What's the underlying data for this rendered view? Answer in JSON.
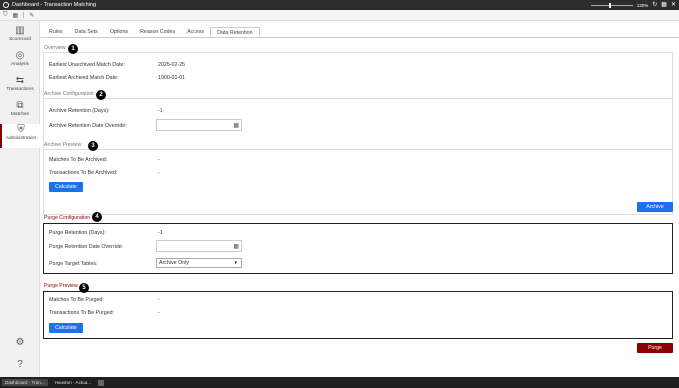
{
  "window": {
    "title": "Dashboard - Transaction Matching",
    "zoom": "130%"
  },
  "sidebar": {
    "items": [
      {
        "label": "Scorecard",
        "icon": "bar-chart-icon"
      },
      {
        "label": "Analysis",
        "icon": "analysis-icon"
      },
      {
        "label": "Transactions",
        "icon": "transactions-icon"
      },
      {
        "label": "Matches",
        "icon": "matches-icon"
      },
      {
        "label": "Administration",
        "icon": "shield-icon"
      }
    ]
  },
  "tabs": [
    "Rules",
    "Data Sets",
    "Options",
    "Reason Codes",
    "Access",
    "Data Retention"
  ],
  "overview": {
    "title": "Overview",
    "badge": "1",
    "rows": [
      {
        "label": "Earliest Unarchived Match Date:",
        "value": "2025-02-25"
      },
      {
        "label": "Earliest Archived Match Date:",
        "value": "1900-01-01"
      }
    ]
  },
  "archive_config": {
    "title": "Archive Configuration",
    "badge": "2",
    "retention_label": "Archive Retention (Days):",
    "retention_value": "-1",
    "override_label": "Archive Retention Date Override:",
    "override_value": ""
  },
  "archive_preview": {
    "title": "Archive Preview",
    "badge": "3",
    "matches_label": "Matches To Be Archived:",
    "matches_value": "-",
    "transactions_label": "Transactions To Be Archived:",
    "transactions_value": "-",
    "calculate_label": "Calculate"
  },
  "archive_button": "Archive",
  "purge_config": {
    "title": "Purge Configuration",
    "badge": "4",
    "retention_label": "Purge Retention (Days):",
    "retention_value": "-1",
    "override_label": "Purge Retention Date Override:",
    "override_value": "",
    "tables_label": "Purge Target Tables:",
    "tables_value": "Archive Only"
  },
  "purge_preview": {
    "title": "Purge Preview",
    "badge": "5",
    "matches_label": "Matches To Be Purged:",
    "matches_value": "-",
    "transactions_label": "Transactions To Be Purged:",
    "transactions_value": "-",
    "calculate_label": "Calculate"
  },
  "purge_button": "Purge",
  "taskbar": [
    {
      "label": "Dashboard - Tran..."
    },
    {
      "label": "Houston - Actua..."
    }
  ],
  "colors": {
    "accent_blue": "#1a73e8",
    "accent_red": "#8b0000"
  }
}
